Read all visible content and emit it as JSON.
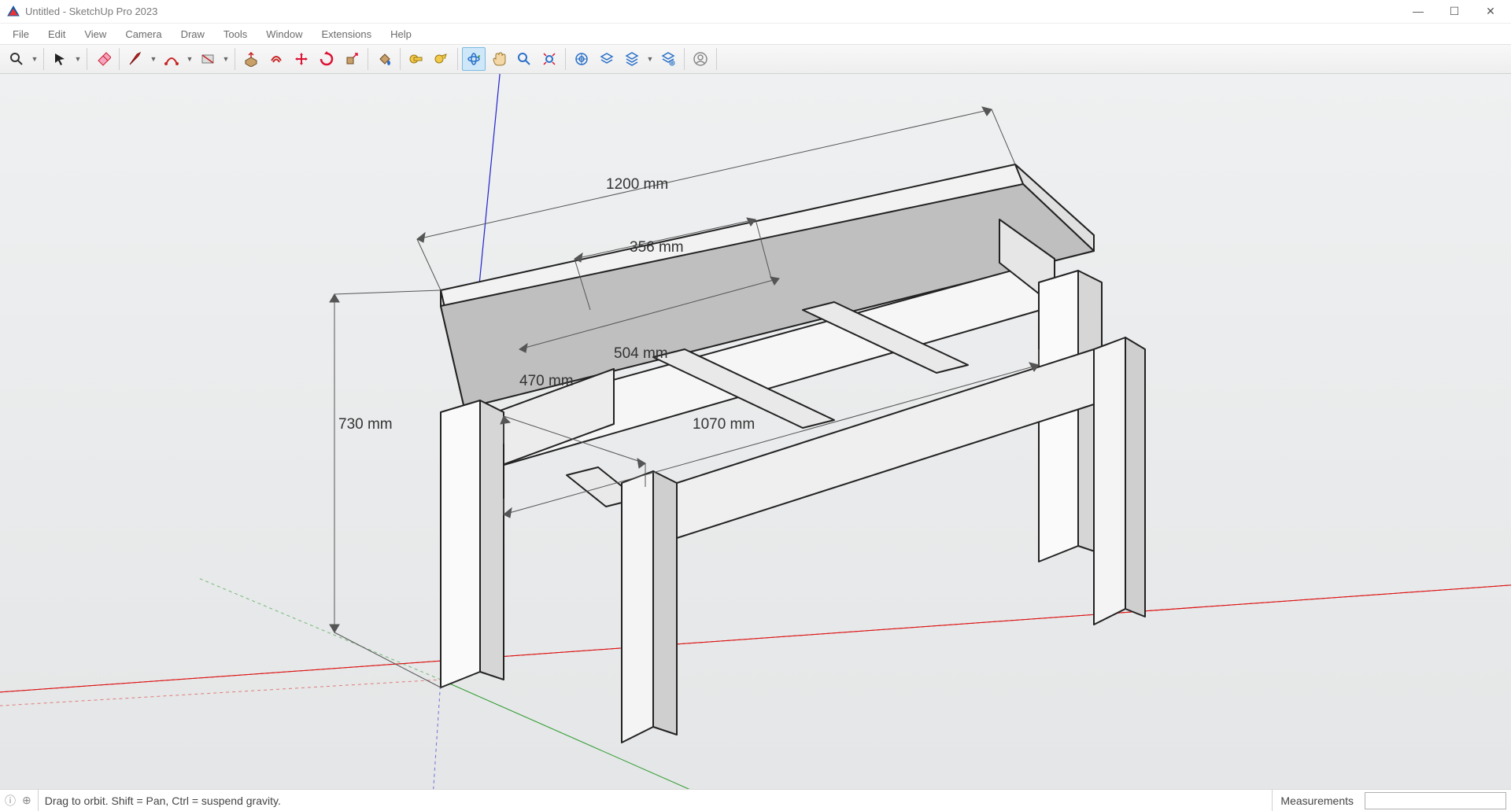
{
  "titlebar": {
    "title": "Untitled - SketchUp Pro 2023"
  },
  "menu": {
    "items": [
      "File",
      "Edit",
      "View",
      "Camera",
      "Draw",
      "Tools",
      "Window",
      "Extensions",
      "Help"
    ]
  },
  "toolbar": {
    "active_tool": "orbit"
  },
  "dimensions": {
    "d_1200": "1200 mm",
    "d_356": "356 mm",
    "d_504": "504 mm",
    "d_470": "470 mm",
    "d_1070": "1070 mm",
    "d_730": "730 mm"
  },
  "statusbar": {
    "hint": "Drag to orbit. Shift = Pan, Ctrl = suspend gravity.",
    "measurements_label": "Measurements",
    "measurements_value": ""
  }
}
